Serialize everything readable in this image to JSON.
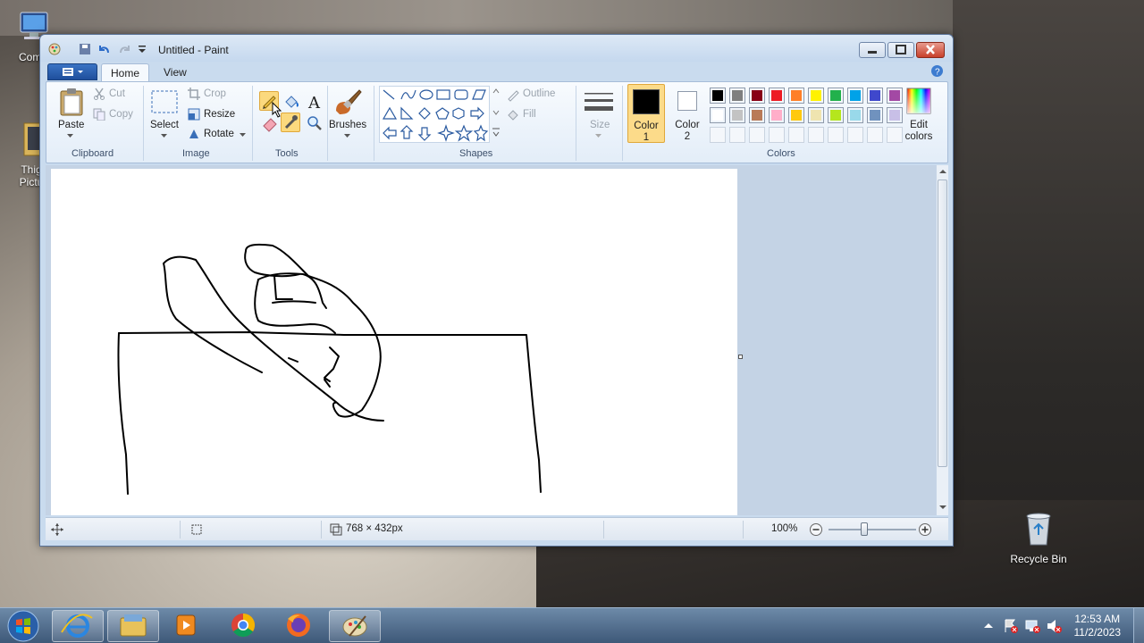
{
  "desktop": {
    "icons": [
      {
        "label": "Comp"
      },
      {
        "label": "Thig\nPictu"
      },
      {
        "label": "Recycle Bin"
      }
    ]
  },
  "window": {
    "title": "Untitled - Paint",
    "tabs": [
      "Home",
      "View"
    ]
  },
  "ribbon": {
    "clipboard": {
      "paste": "Paste",
      "cut": "Cut",
      "copy": "Copy",
      "label": "Clipboard"
    },
    "image": {
      "select": "Select",
      "crop": "Crop",
      "resize": "Resize",
      "rotate": "Rotate",
      "label": "Image"
    },
    "tools": {
      "label": "Tools"
    },
    "brushes": {
      "label": "Brushes"
    },
    "shapes": {
      "outline": "Outline",
      "fill": "Fill",
      "label": "Shapes"
    },
    "size": {
      "label": "Size"
    },
    "colors": {
      "color1": "Color\n1",
      "color2": "Color\n2",
      "edit": "Edit\ncolors",
      "label": "Colors",
      "color1_value": "#000000",
      "color2_value": "#ffffff",
      "palette_row1": [
        "#000000",
        "#7f7f7f",
        "#880015",
        "#ed1c24",
        "#ff7f27",
        "#fff200",
        "#22b14c",
        "#00a2e8",
        "#3f48cc",
        "#a349a4"
      ],
      "palette_row2": [
        "#ffffff",
        "#c3c3c3",
        "#b97a57",
        "#ffaec9",
        "#ffc90e",
        "#efe4b0",
        "#b5e61d",
        "#99d9ea",
        "#7092be",
        "#c8bfe7"
      ]
    }
  },
  "status": {
    "dimensions": "768 × 432px",
    "zoom": "100%"
  },
  "taskbar": {
    "time": "12:53 AM",
    "date": "11/2/2023"
  }
}
